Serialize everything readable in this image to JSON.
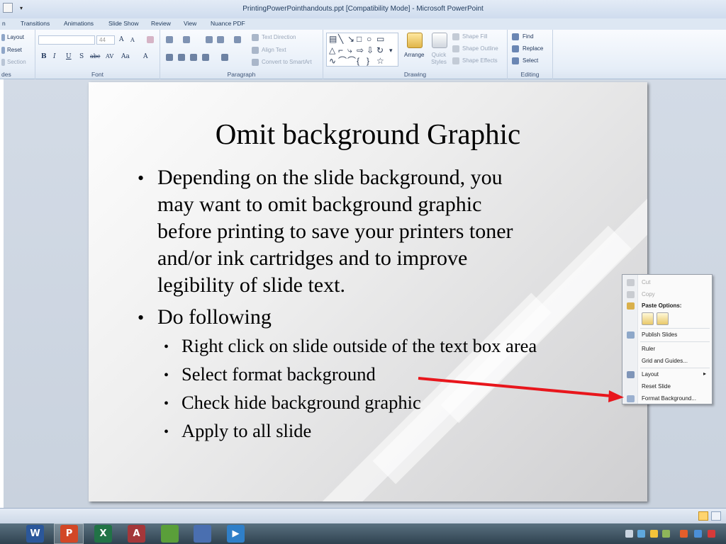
{
  "window": {
    "title": "PrintingPowerPointhandouts.ppt [Compatibility Mode]  -  Microsoft PowerPoint"
  },
  "tabs": [
    "n",
    "Transitions",
    "Animations",
    "Slide Show",
    "Review",
    "View",
    "Nuance PDF"
  ],
  "ribbon": {
    "slides": {
      "layout": "Layout",
      "reset": "Reset",
      "section": "Section",
      "label": "des"
    },
    "font": {
      "size": "44",
      "grow": "A",
      "shrink": "A",
      "bold": "B",
      "italic": "I",
      "underline": "U",
      "shadow": "S",
      "strike": "abc",
      "spacing": "AV",
      "case": "Aa",
      "color": "A",
      "label": "Font"
    },
    "paragraph": {
      "text_direction": "Text Direction",
      "align_text": "Align Text",
      "convert_smartart": "Convert to SmartArt",
      "label": "Paragraph"
    },
    "drawing": {
      "arrange": "Arrange",
      "quick_styles": "Quick Styles",
      "shape_fill": "Shape Fill",
      "shape_outline": "Shape Outline",
      "shape_effects": "Shape Effects",
      "label": "Drawing"
    },
    "editing": {
      "find": "Find",
      "replace": "Replace",
      "select": "Select",
      "label": "Editing"
    }
  },
  "slide": {
    "title": "Omit background Graphic",
    "bullets": [
      "Depending on the slide background, you",
      "may want to omit background graphic",
      "before printing to save your printers toner",
      "and/or ink cartridges and to improve",
      "legibility of slide text.",
      "Do following"
    ],
    "sub_bullets": [
      "Right click on slide outside of the text box area",
      "Select format background",
      "Check hide background graphic",
      "Apply to all slide"
    ],
    "bullet_char": "•"
  },
  "context_menu": {
    "cut": "Cut",
    "copy": "Copy",
    "paste_options": "Paste Options:",
    "publish_slides": "Publish Slides",
    "ruler": "Ruler",
    "grid_guides": "Grid and Guides...",
    "layout": "Layout",
    "submenu_arrow": "▸",
    "reset_slide": "Reset Slide",
    "format_background": "Format Background..."
  },
  "colors": {
    "annotation_arrow": "#e8161c",
    "ribbon_label": "#3d5376",
    "taskbar": "#3a4e5c"
  },
  "taskbar": {
    "apps": [
      {
        "name": "word",
        "glyph": "W",
        "color": "#2b579a"
      },
      {
        "name": "powerpoint",
        "glyph": "P",
        "color": "#d24726"
      },
      {
        "name": "excel",
        "glyph": "X",
        "color": "#217346"
      },
      {
        "name": "access",
        "glyph": "A",
        "color": "#a4373a"
      },
      {
        "name": "publisher",
        "glyph": "",
        "color": "#5a9f3a"
      },
      {
        "name": "onenote",
        "glyph": "",
        "color": "#4a6fb0"
      },
      {
        "name": "media",
        "glyph": "▶",
        "color": "#2f7fc8"
      }
    ]
  }
}
